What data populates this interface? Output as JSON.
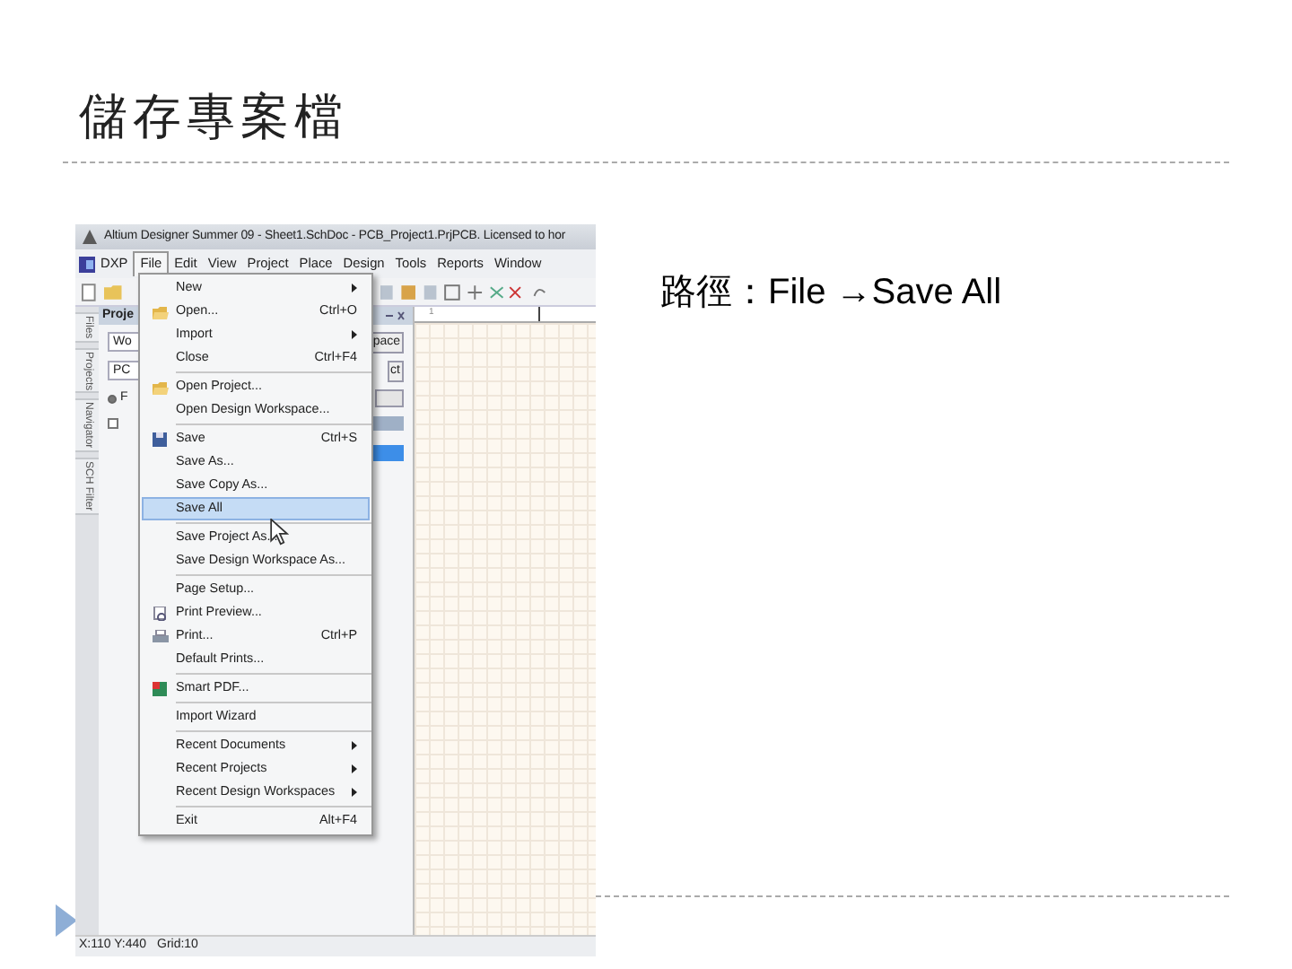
{
  "slide": {
    "title": "儲存專案檔",
    "caption": "路徑：File →Save All"
  },
  "window": {
    "title": "Altium Designer Summer 09 - Sheet1.SchDoc - PCB_Project1.PrjPCB. Licensed to hor"
  },
  "menubar": [
    {
      "label": "DXP",
      "selected": false
    },
    {
      "label": "File",
      "selected": true
    },
    {
      "label": "Edit",
      "selected": false
    },
    {
      "label": "View",
      "selected": false
    },
    {
      "label": "Project",
      "selected": false
    },
    {
      "label": "Place",
      "selected": false
    },
    {
      "label": "Design",
      "selected": false
    },
    {
      "label": "Tools",
      "selected": false
    },
    {
      "label": "Reports",
      "selected": false
    },
    {
      "label": "Window",
      "selected": false
    }
  ],
  "side_tabs": [
    "Files",
    "Projects",
    "Navigator",
    "SCH Filter"
  ],
  "panel": {
    "title": "Proje",
    "field_1": "Wo",
    "field_2": "PC",
    "button_1": "pace",
    "button_2": "ct",
    "radio": "F",
    "radio_checked": true
  },
  "document_tab": "1",
  "file_menu": [
    {
      "kind": "submenu",
      "label": "New",
      "selected": false
    },
    {
      "kind": "folder",
      "label": "Open...",
      "shortcut": "Ctrl+O",
      "selected": false
    },
    {
      "kind": "submenu",
      "label": "Import",
      "selected": false
    },
    {
      "kind": "item",
      "label": "Close",
      "shortcut": "Ctrl+F4",
      "selected": false
    },
    {
      "kind": "separator"
    },
    {
      "kind": "folder",
      "label": "Open Project...",
      "selected": false
    },
    {
      "kind": "item",
      "label": "Open Design Workspace...",
      "selected": false
    },
    {
      "kind": "separator"
    },
    {
      "kind": "disk",
      "label": "Save",
      "shortcut": "Ctrl+S",
      "selected": false
    },
    {
      "kind": "item",
      "label": "Save As...",
      "selected": false
    },
    {
      "kind": "item",
      "label": "Save Copy As...",
      "selected": false
    },
    {
      "kind": "item",
      "label": "Save All",
      "selected": true
    },
    {
      "kind": "separator"
    },
    {
      "kind": "item",
      "label": "Save Project As...",
      "selected": false
    },
    {
      "kind": "item",
      "label": "Save Design Workspace As...",
      "selected": false
    },
    {
      "kind": "separator"
    },
    {
      "kind": "item",
      "label": "Page Setup...",
      "selected": false
    },
    {
      "kind": "preview",
      "label": "Print Preview...",
      "selected": false
    },
    {
      "kind": "printer",
      "label": "Print...",
      "shortcut": "Ctrl+P",
      "selected": false
    },
    {
      "kind": "item",
      "label": "Default Prints...",
      "selected": false
    },
    {
      "kind": "separator"
    },
    {
      "kind": "pdf",
      "label": "Smart PDF...",
      "selected": false
    },
    {
      "kind": "separator"
    },
    {
      "kind": "item",
      "label": "Import Wizard",
      "selected": false
    },
    {
      "kind": "separator"
    },
    {
      "kind": "submenu",
      "label": "Recent Documents",
      "selected": false
    },
    {
      "kind": "submenu",
      "label": "Recent Projects",
      "selected": false
    },
    {
      "kind": "submenu",
      "label": "Recent Design Workspaces",
      "selected": false
    },
    {
      "kind": "separator"
    },
    {
      "kind": "item",
      "label": "Exit",
      "shortcut": "Alt+F4",
      "selected": false
    }
  ],
  "status_bar": {
    "position": "X:110 Y:440",
    "grid": "Grid:10"
  }
}
